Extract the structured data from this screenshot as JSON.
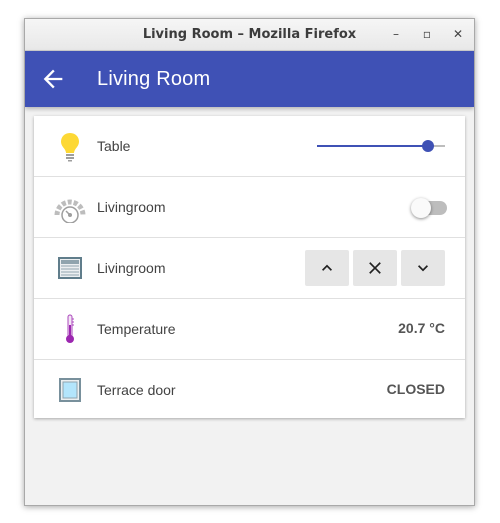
{
  "window": {
    "title": "Living Room – Mozilla Firefox",
    "controls": {
      "minimize": "–",
      "maximize": "▫",
      "close": "✕"
    }
  },
  "appbar": {
    "back_icon": "arrow-left-icon",
    "title": "Living Room",
    "color": "#3f51b5"
  },
  "rows": [
    {
      "icon": "lightbulb-icon",
      "label": "Table",
      "control": "slider",
      "level": 0.87
    },
    {
      "icon": "smoke-detector-icon",
      "label": "Livingroom",
      "control": "toggle",
      "on": false
    },
    {
      "icon": "window-shutter-icon",
      "label": "Livingroom",
      "control": "cover-buttons",
      "buttons": [
        "chevron-up-icon",
        "stop-x-icon",
        "chevron-down-icon"
      ]
    },
    {
      "icon": "thermometer-icon",
      "label": "Temperature",
      "value": "20.7 °C"
    },
    {
      "icon": "door-icon",
      "label": "Terrace door",
      "value": "CLOSED"
    }
  ]
}
